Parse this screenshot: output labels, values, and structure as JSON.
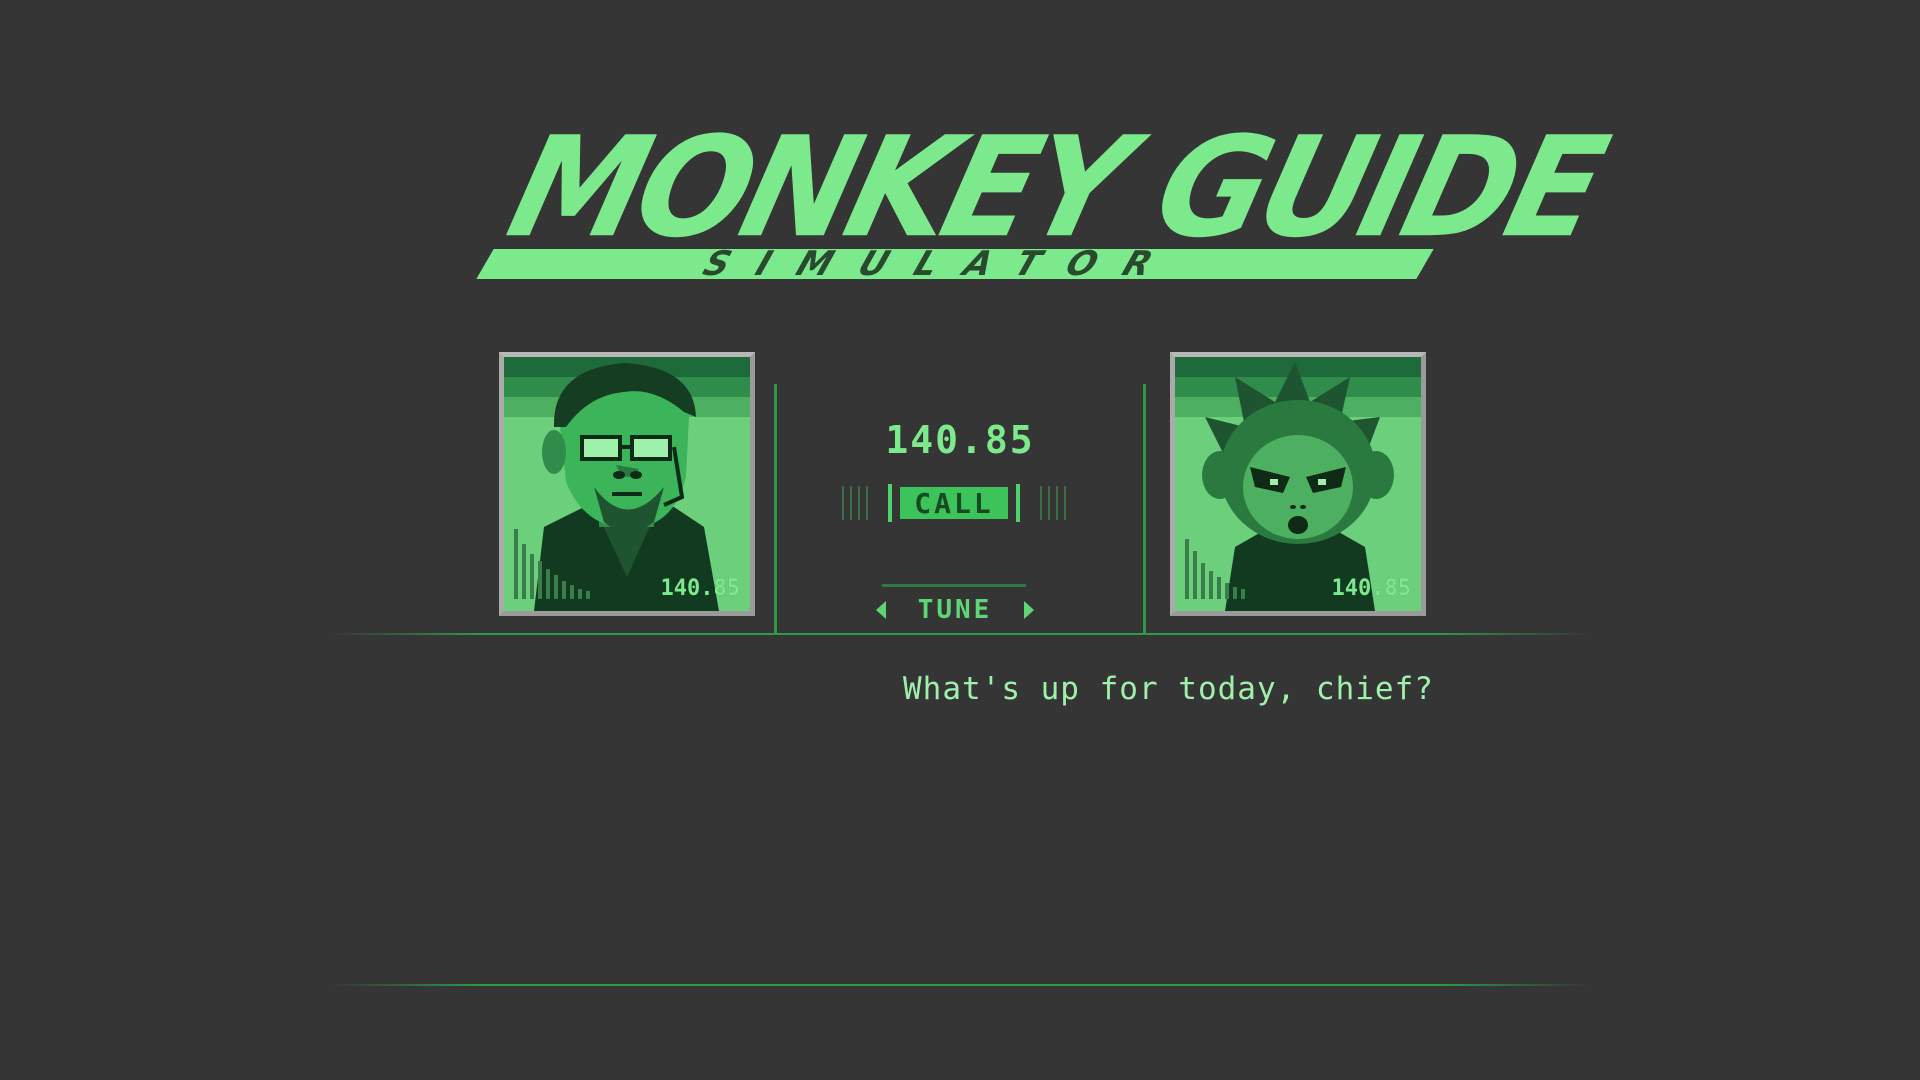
{
  "logo": {
    "title": "MONKEY GUIDE",
    "subtitle": "SIMULATOR"
  },
  "left_portrait": {
    "character": "bearded man with glasses and headset",
    "frequency": "140.85"
  },
  "right_portrait": {
    "character": "monkey",
    "frequency": "140.85"
  },
  "codec": {
    "frequency": "140.85",
    "call_label": "CALL",
    "tune_label": "TUNE"
  },
  "dialogue": {
    "text": "What's up for today, chief?"
  },
  "colors": {
    "background": "#353535",
    "accent": "#7cea8c",
    "line": "#2f9a48",
    "call_fill": "#3cc45a"
  }
}
